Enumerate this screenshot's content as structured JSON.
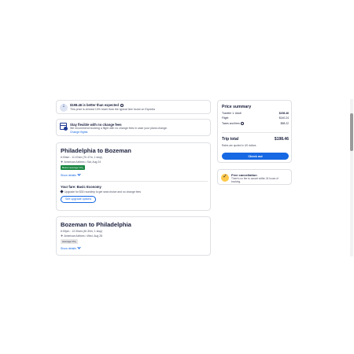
{
  "price_note": {
    "icon": "arrow-down-icon",
    "title": "$198.46 is better than expected",
    "description": "This price is at least 10% lower than the typical fare found on Expedia"
  },
  "flexible": {
    "icon": "calendar-icon",
    "title": "Stay flexible with no change fees",
    "description": "We recommend booking a flight with no change fees in case your plans change.",
    "link": "Change flights"
  },
  "flights": [
    {
      "route": "Philadelphia to Bozeman",
      "times": "6:00am - 11:47am (7h 47m, 1 stop)",
      "airline": "American Airlines • Sat, Aug 24",
      "badge": "Below average CO₂",
      "details_link": "Show details",
      "fare_title": "Your fare: Basic Economy",
      "fare_desc": "Upgrade for $30 roundtrip to get seat choice and no change fees",
      "upgrade_button": "See upgrade options"
    },
    {
      "route": "Bozeman to Philadelphia",
      "times": "6:00pm - 12:30am (4h 30m, 1 stop)",
      "airline": "American Airlines • Wed, Aug 28",
      "badge": "Average CO₂",
      "details_link": "Show details"
    }
  ],
  "summary": {
    "title": "Price summary",
    "rows": [
      {
        "label": "Traveler 1: Adult",
        "value": "$198.46"
      },
      {
        "label": "Flight",
        "value": "$140.24"
      },
      {
        "label": "Taxes and fees",
        "value": "$58.22"
      }
    ],
    "total_label": "Trip total",
    "total_value": "$198.46",
    "quoted": "Rates are quoted in US dollars",
    "checkout_button": "Check out"
  },
  "cancellation": {
    "icon": "checkmark-icon",
    "title": "Free cancellation",
    "description": "There's no fee to cancel within 24 hours of booking."
  },
  "colors": {
    "primary": "#1668e3",
    "navy": "#191e3b",
    "green_badge": "#1b8742",
    "yellow_icon": "#ffc94c"
  }
}
